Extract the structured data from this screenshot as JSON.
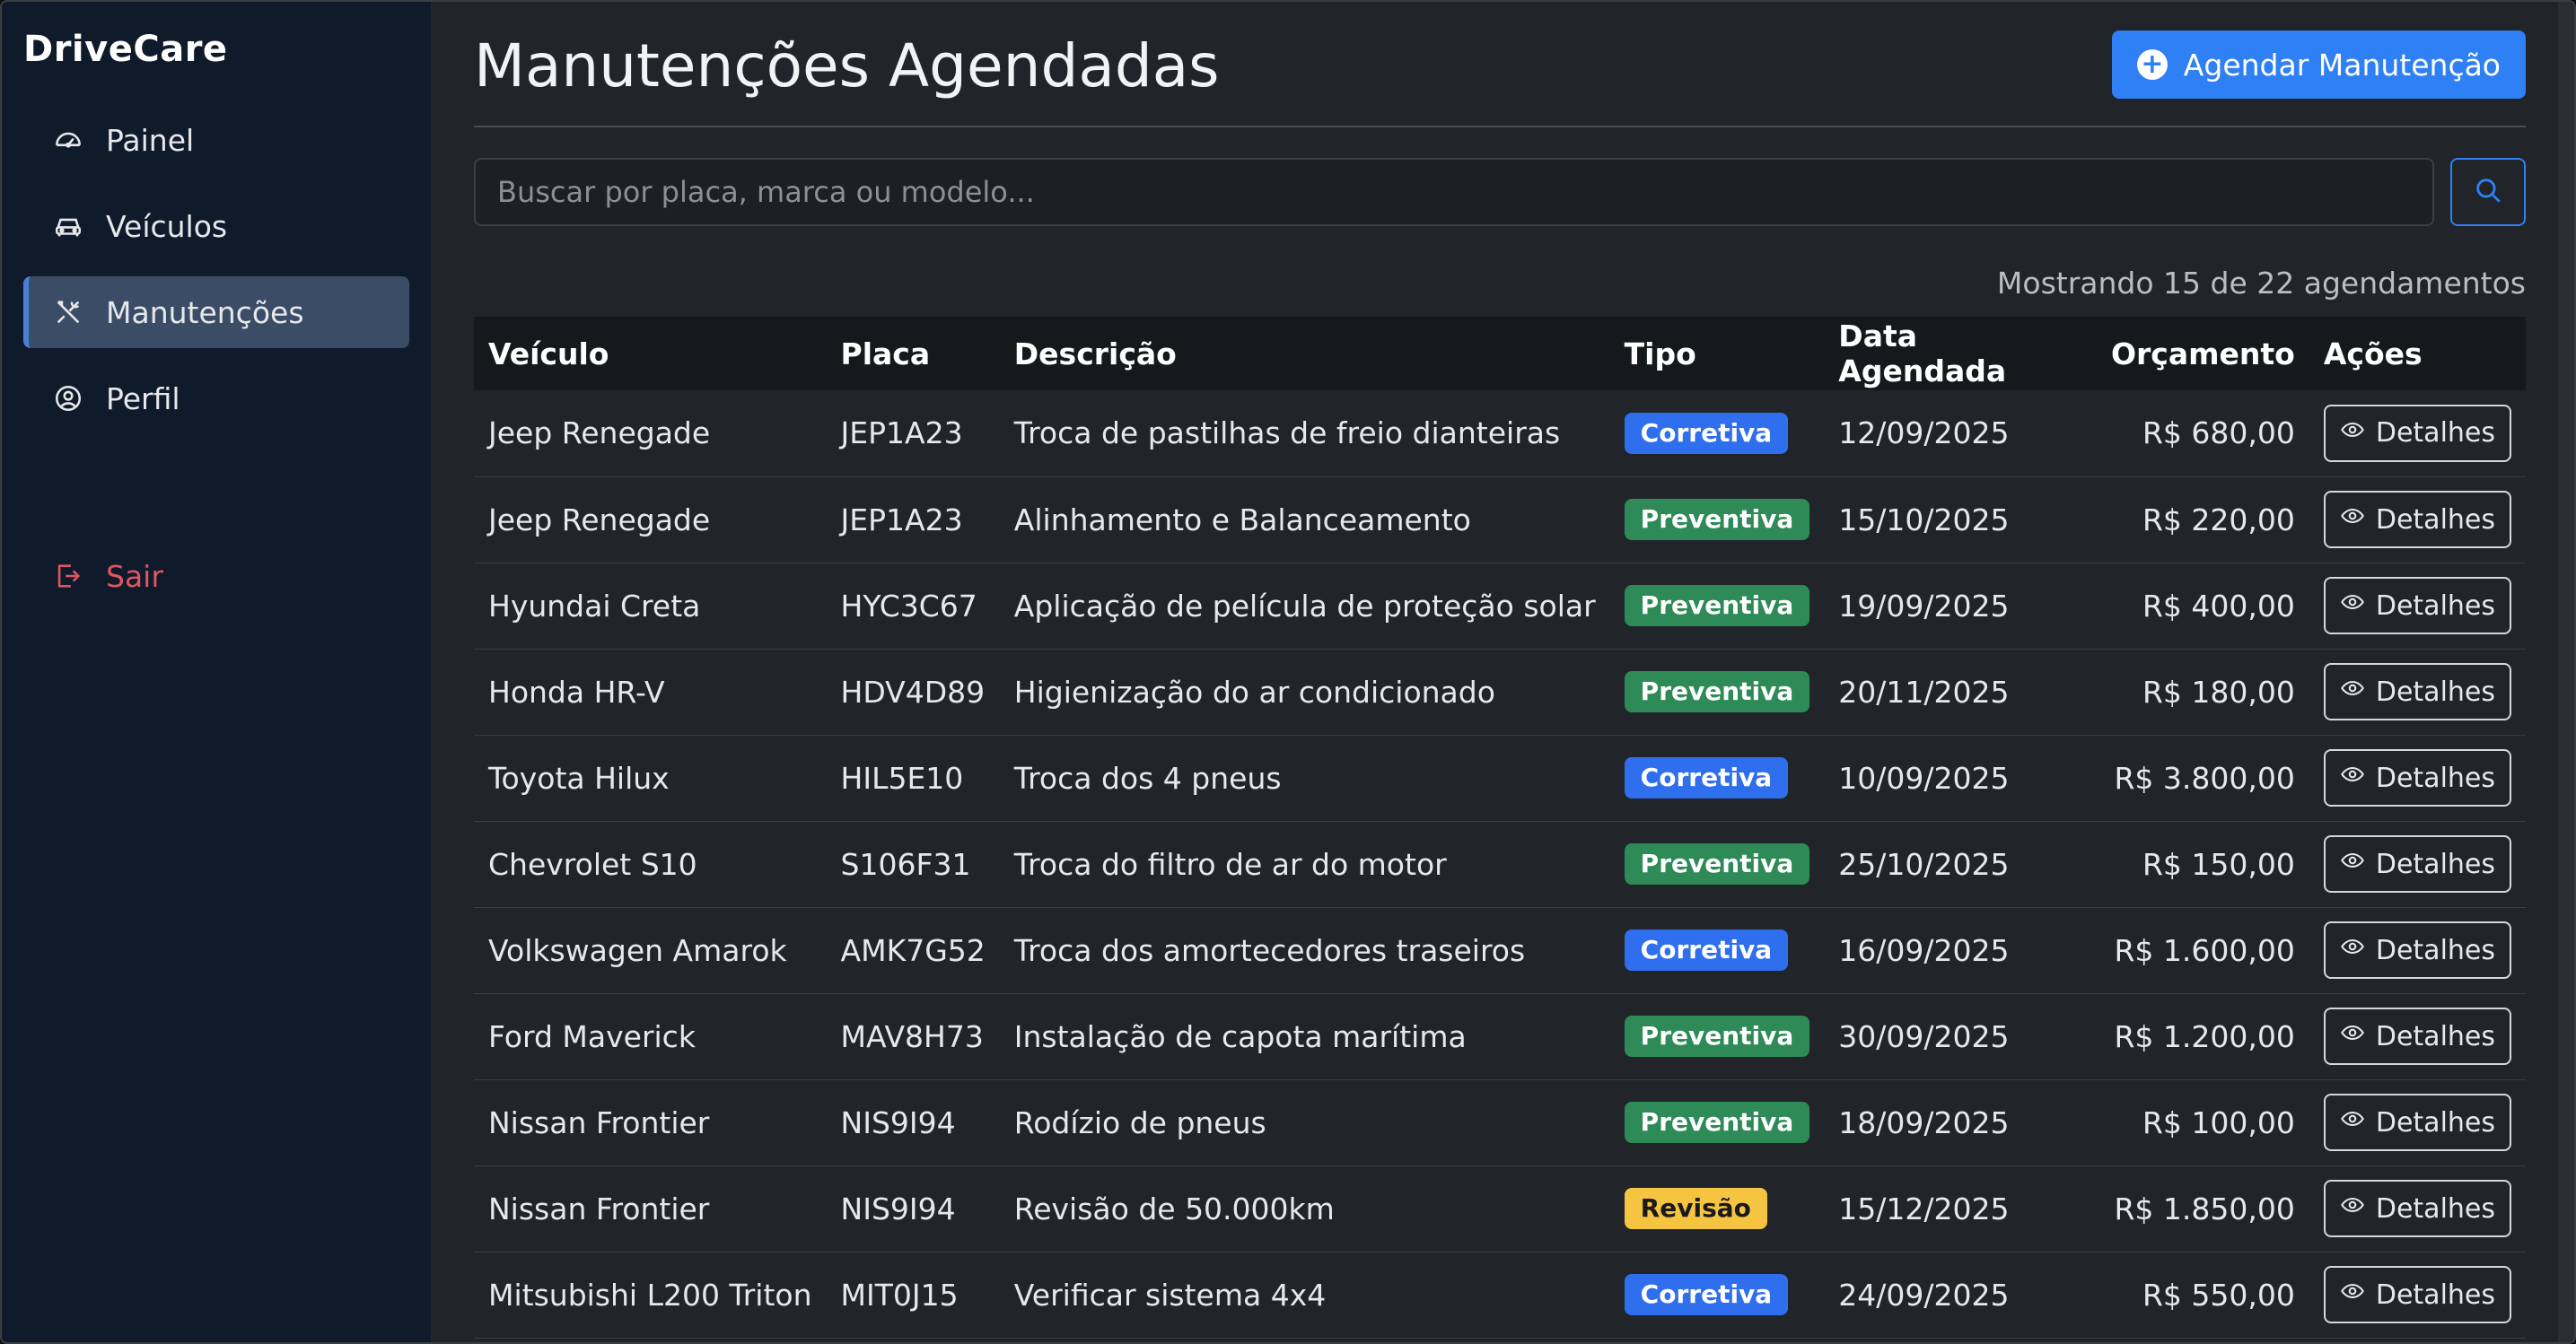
{
  "brand": "DriveCare",
  "sidebar": {
    "items": [
      {
        "label": "Painel",
        "icon": "speedometer-icon",
        "active": false
      },
      {
        "label": "Veículos",
        "icon": "car-icon",
        "active": false
      },
      {
        "label": "Manutenções",
        "icon": "tools-icon",
        "active": true
      },
      {
        "label": "Perfil",
        "icon": "user-circle-icon",
        "active": false
      }
    ],
    "logout": {
      "label": "Sair",
      "icon": "logout-icon"
    }
  },
  "header": {
    "title": "Manutenções Agendadas",
    "action_label": "Agendar Manutenção",
    "action_icon": "plus-circle-icon"
  },
  "search": {
    "placeholder": "Buscar por placa, marca ou modelo...",
    "button_icon": "search-icon"
  },
  "summary": "Mostrando 15 de 22 agendamentos",
  "table": {
    "columns": [
      "Veículo",
      "Placa",
      "Descrição",
      "Tipo",
      "Data Agendada",
      "Orçamento",
      "Ações"
    ],
    "action_label": "Detalhes",
    "rows": [
      {
        "vehicle": "Jeep Renegade",
        "plate": "JEP1A23",
        "description": "Troca de pastilhas de freio dianteiras",
        "type": "Corretiva",
        "date": "12/09/2025",
        "budget": "R$ 680,00"
      },
      {
        "vehicle": "Jeep Renegade",
        "plate": "JEP1A23",
        "description": "Alinhamento e Balanceamento",
        "type": "Preventiva",
        "date": "15/10/2025",
        "budget": "R$ 220,00"
      },
      {
        "vehicle": "Hyundai Creta",
        "plate": "HYC3C67",
        "description": "Aplicação de película de proteção solar",
        "type": "Preventiva",
        "date": "19/09/2025",
        "budget": "R$ 400,00"
      },
      {
        "vehicle": "Honda HR-V",
        "plate": "HDV4D89",
        "description": "Higienização do ar condicionado",
        "type": "Preventiva",
        "date": "20/11/2025",
        "budget": "R$ 180,00"
      },
      {
        "vehicle": "Toyota Hilux",
        "plate": "HIL5E10",
        "description": "Troca dos 4 pneus",
        "type": "Corretiva",
        "date": "10/09/2025",
        "budget": "R$ 3.800,00"
      },
      {
        "vehicle": "Chevrolet S10",
        "plate": "S106F31",
        "description": "Troca do filtro de ar do motor",
        "type": "Preventiva",
        "date": "25/10/2025",
        "budget": "R$ 150,00"
      },
      {
        "vehicle": "Volkswagen Amarok",
        "plate": "AMK7G52",
        "description": "Troca dos amortecedores traseiros",
        "type": "Corretiva",
        "date": "16/09/2025",
        "budget": "R$ 1.600,00"
      },
      {
        "vehicle": "Ford Maverick",
        "plate": "MAV8H73",
        "description": "Instalação de capota marítima",
        "type": "Preventiva",
        "date": "30/09/2025",
        "budget": "R$ 1.200,00"
      },
      {
        "vehicle": "Nissan Frontier",
        "plate": "NIS9I94",
        "description": "Rodízio de pneus",
        "type": "Preventiva",
        "date": "18/09/2025",
        "budget": "R$ 100,00"
      },
      {
        "vehicle": "Nissan Frontier",
        "plate": "NIS9I94",
        "description": "Revisão de 50.000km",
        "type": "Revisão",
        "date": "15/12/2025",
        "budget": "R$ 1.850,00"
      },
      {
        "vehicle": "Mitsubishi L200 Triton",
        "plate": "MIT0J15",
        "description": "Verificar sistema 4x4",
        "type": "Corretiva",
        "date": "24/09/2025",
        "budget": "R$ 550,00"
      }
    ]
  },
  "badge_colors": {
    "Corretiva": {
      "bg": "#2f6fed",
      "fg": "#ffffff"
    },
    "Preventiva": {
      "bg": "#2e8a57",
      "fg": "#ffffff"
    },
    "Revisão": {
      "bg": "#f5c542",
      "fg": "#1a1a1a"
    }
  },
  "colors": {
    "accent": "#2f7ff5",
    "sidebar_bg": "#0f1a2b",
    "main_bg": "#212529",
    "danger": "#e05563"
  }
}
